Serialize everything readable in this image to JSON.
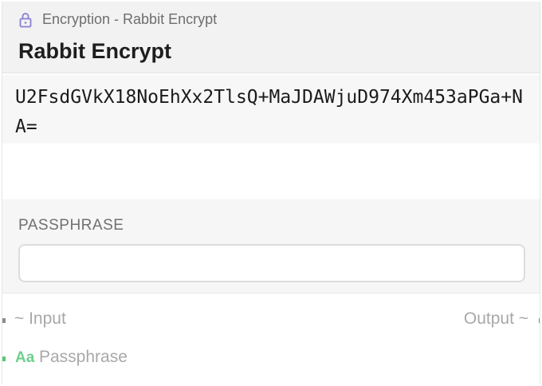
{
  "node": {
    "type_label": "Encryption - Rabbit Encrypt",
    "title": "Rabbit Encrypt",
    "output_text": "U2FsdGVkX18NoEhXx2TlsQ+MaJDAWjuD974Xm453aPGa+NA="
  },
  "settings": {
    "passphrase_label": "PASSPHRASE",
    "passphrase_value": ""
  },
  "ports": {
    "input_label": "~ Input",
    "output_label": "Output ~",
    "passphrase_icon": "Aa",
    "passphrase_label": "Passphrase"
  },
  "colors": {
    "lock_icon": "#8a7fd6",
    "port_gray": "#8c8c8c",
    "port_green": "#5cc878"
  }
}
